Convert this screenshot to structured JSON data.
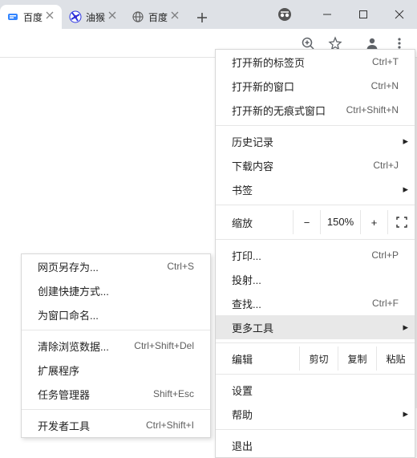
{
  "tabs": [
    {
      "title": "百度",
      "favicon": "baidu-blue"
    },
    {
      "title": "油猴",
      "favicon": "baidu-fan"
    },
    {
      "title": "百度",
      "favicon": "globe"
    }
  ],
  "menu": {
    "new_tab": "打开新的标签页",
    "new_tab_sc": "Ctrl+T",
    "new_window": "打开新的窗口",
    "new_window_sc": "Ctrl+N",
    "new_incognito": "打开新的无痕式窗口",
    "new_incognito_sc": "Ctrl+Shift+N",
    "history": "历史记录",
    "downloads": "下载内容",
    "downloads_sc": "Ctrl+J",
    "bookmarks": "书签",
    "zoom": "缩放",
    "zoom_val": "150%",
    "print": "打印...",
    "print_sc": "Ctrl+P",
    "cast": "投射...",
    "find": "查找...",
    "find_sc": "Ctrl+F",
    "more_tools": "更多工具",
    "edit": "编辑",
    "cut": "剪切",
    "copy": "复制",
    "paste": "粘贴",
    "settings": "设置",
    "help": "帮助",
    "exit": "退出"
  },
  "submenu": {
    "save_as": "网页另存为...",
    "save_as_sc": "Ctrl+S",
    "create_shortcut": "创建快捷方式...",
    "name_window": "为窗口命名...",
    "clear_data": "清除浏览数据...",
    "clear_data_sc": "Ctrl+Shift+Del",
    "extensions": "扩展程序",
    "task_manager": "任务管理器",
    "task_manager_sc": "Shift+Esc",
    "dev_tools": "开发者工具",
    "dev_tools_sc": "Ctrl+Shift+I"
  }
}
